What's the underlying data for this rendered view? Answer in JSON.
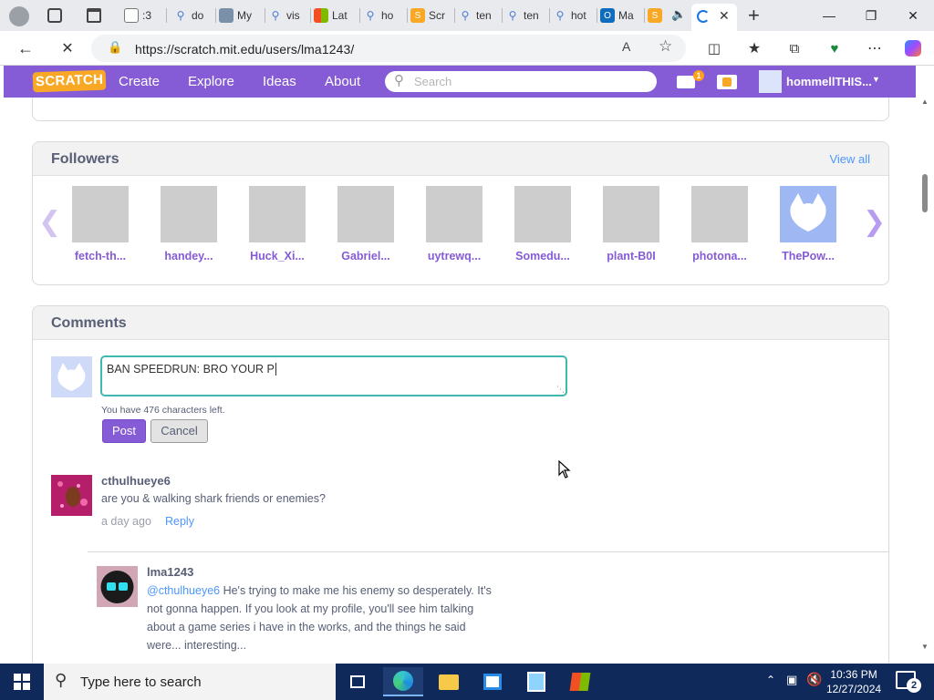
{
  "browser": {
    "tabs": [
      {
        "label": ":3",
        "icon": "document-icon"
      },
      {
        "label": "do",
        "icon": "search-icon"
      },
      {
        "label": "My",
        "icon": "image-icon"
      },
      {
        "label": "vis",
        "icon": "search-icon"
      },
      {
        "label": "Lat",
        "icon": "windows-icon"
      },
      {
        "label": "ho",
        "icon": "search-icon"
      },
      {
        "label": "Scr",
        "icon": "scratch-icon"
      },
      {
        "label": "ten",
        "icon": "search-icon"
      },
      {
        "label": "ten",
        "icon": "search-icon"
      },
      {
        "label": "hot",
        "icon": "search-icon"
      },
      {
        "label": "Ma",
        "icon": "outlook-icon"
      }
    ],
    "url": "https://scratch.mit.edu/users/lma1243/"
  },
  "scratch_nav": {
    "logo": "SCRATCH",
    "links": [
      "Create",
      "Explore",
      "Ideas",
      "About"
    ],
    "search_placeholder": "Search",
    "mail_badge": "1",
    "username": "hommellTHIS..."
  },
  "followers": {
    "title": "Followers",
    "view_all": "View all",
    "items": [
      {
        "name": "fetch-th..."
      },
      {
        "name": "handey..."
      },
      {
        "name": "Huck_Xi..."
      },
      {
        "name": "Gabriel..."
      },
      {
        "name": "uytrewq..."
      },
      {
        "name": "Somedu..."
      },
      {
        "name": "plant-B0I"
      },
      {
        "name": "photona..."
      },
      {
        "name": "ThePow..."
      }
    ]
  },
  "comments": {
    "title": "Comments",
    "draft": "BAN SPEEDRUN: BRO YOUR P",
    "chars_left": "You have 476 characters left.",
    "post_label": "Post",
    "cancel_label": "Cancel",
    "list": [
      {
        "user": "cthulhueye6",
        "text": "are you & walking shark friends or enemies?",
        "time": "a day ago",
        "reply_label": "Reply"
      }
    ],
    "reply": {
      "user": "lma1243",
      "mention": "@cthulhueye6",
      "lines": [
        " He's trying to make me his enemy so desperately. It's",
        "not gonna happen. If you look at my profile, you'll see him talking",
        "about a game series i have in the works, and the things he said",
        "were... interesting..."
      ]
    }
  },
  "taskbar": {
    "search_placeholder": "Type here to search",
    "time": "10:36 PM",
    "date": "12/27/2024",
    "notification_count": "2"
  }
}
